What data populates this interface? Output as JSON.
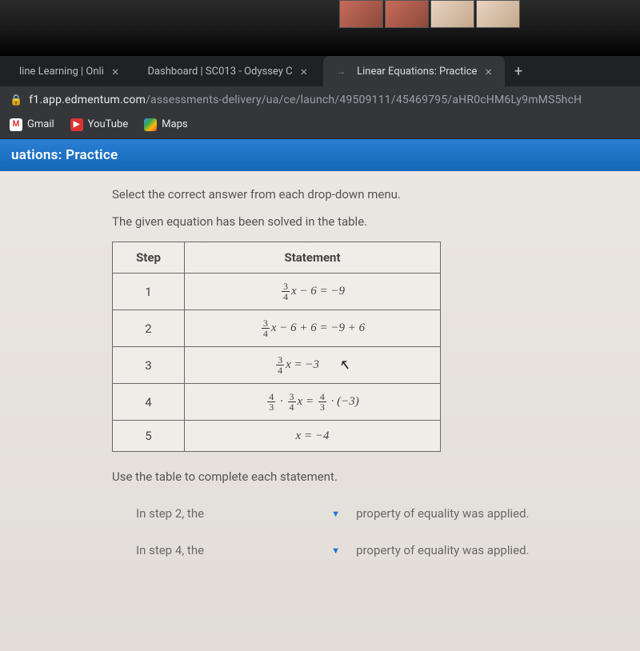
{
  "tabs": [
    {
      "title": "line Learning | Onli"
    },
    {
      "title": "Dashboard | SC013 - Odyssey C"
    },
    {
      "title": "Linear Equations: Practice"
    }
  ],
  "url": {
    "domain": "f1.app.edmentum.com",
    "path": "/assessments-delivery/ua/ce/launch/49509111/45469795/aHR0cHM6Ly9mMS5hcH"
  },
  "bookmarks": [
    {
      "label": "Gmail"
    },
    {
      "label": "YouTube"
    },
    {
      "label": "Maps"
    }
  ],
  "header": "uations: Practice",
  "instruction1": "Select the correct answer from each drop-down menu.",
  "instruction2": "The given equation has been solved in the table.",
  "table_headers": {
    "step": "Step",
    "statement": "Statement"
  },
  "steps": {
    "s1": "1",
    "s2": "2",
    "s3": "3",
    "s4": "4",
    "s5": "5"
  },
  "chart_data": {
    "type": "table",
    "title": "Equation solving steps",
    "columns": [
      "Step",
      "Statement"
    ],
    "rows": [
      {
        "step": 1,
        "statement": "(3/4)x - 6 = -9"
      },
      {
        "step": 2,
        "statement": "(3/4)x - 6 + 6 = -9 + 6"
      },
      {
        "step": 3,
        "statement": "(3/4)x = -3"
      },
      {
        "step": 4,
        "statement": "(4/3) * (3/4)x = (4/3) * (-3)"
      },
      {
        "step": 5,
        "statement": "x = -4"
      }
    ]
  },
  "complete_text": "Use the table to complete each statement.",
  "fill": {
    "line1_a": "In step 2, the",
    "line1_b": "property of equality was applied.",
    "line2_a": "In step 4, the",
    "line2_b": "property of equality was applied."
  }
}
